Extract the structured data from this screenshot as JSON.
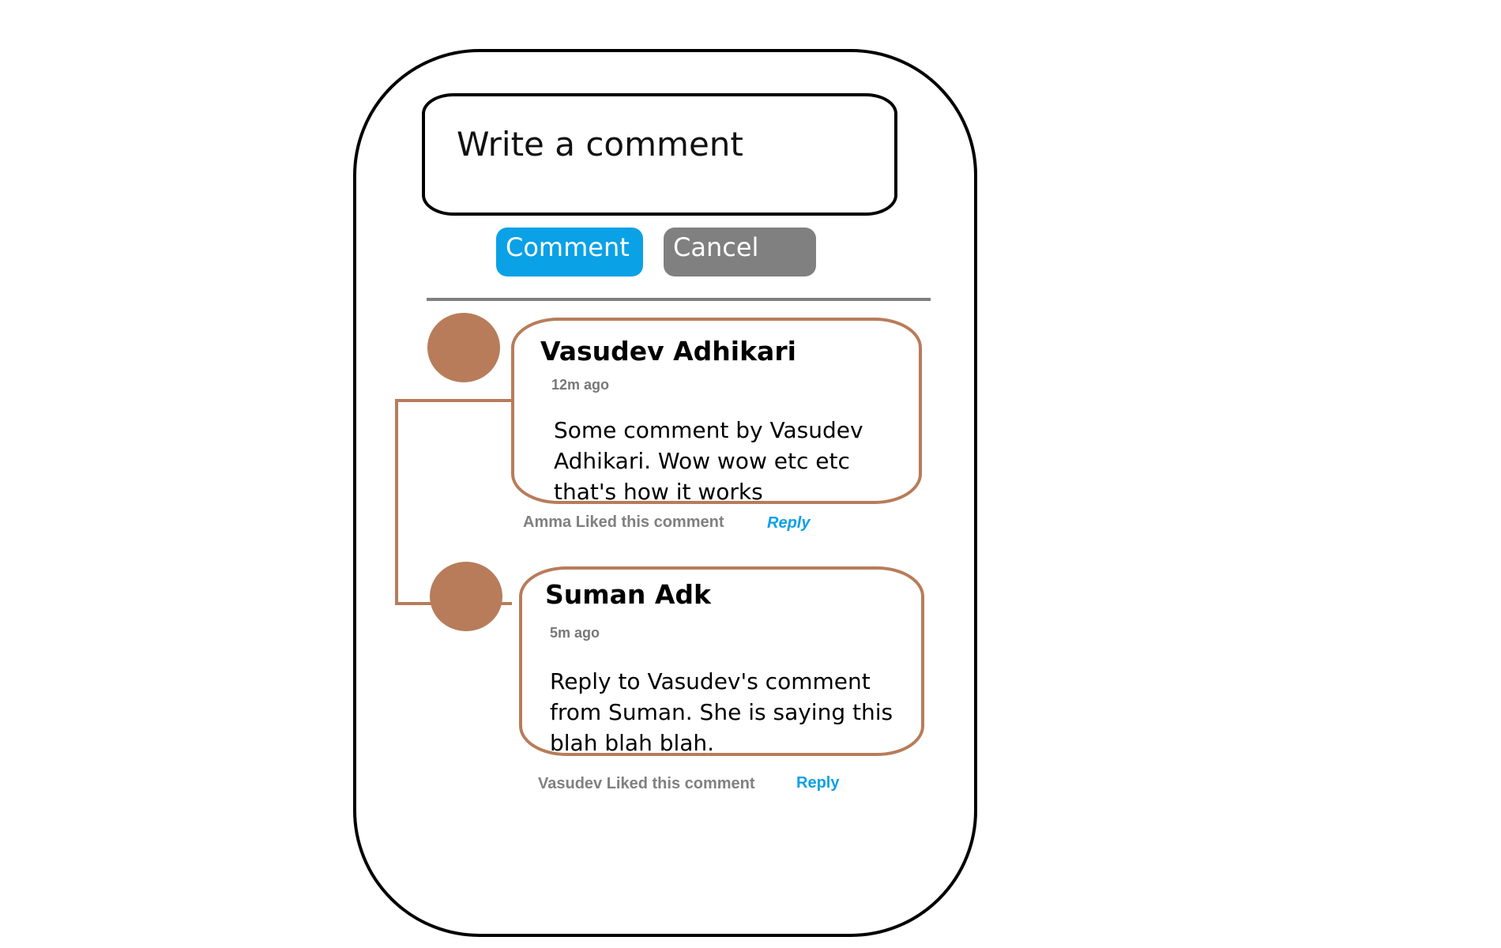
{
  "composer": {
    "placeholder": "Write a comment",
    "comment_button": "Comment",
    "cancel_button": "Cancel"
  },
  "comments": [
    {
      "author": "Vasudev Adhikari",
      "time": "12m ago",
      "text": "Some comment by Vasudev\nAdhikari. Wow wow etc etc\nthat's how it works",
      "likes": "Amma Liked this comment",
      "reply": "Reply"
    },
    {
      "author": "Suman Adk",
      "time": "5m ago",
      "text": "Reply to Vasudev's comment\nfrom Suman. She is saying this\nblah blah blah.",
      "likes": "Vasudev Liked this comment",
      "reply": "Reply"
    }
  ],
  "colors": {
    "primary": "#0aa1e6",
    "secondary": "#808080",
    "accent": "#b87c5a"
  }
}
